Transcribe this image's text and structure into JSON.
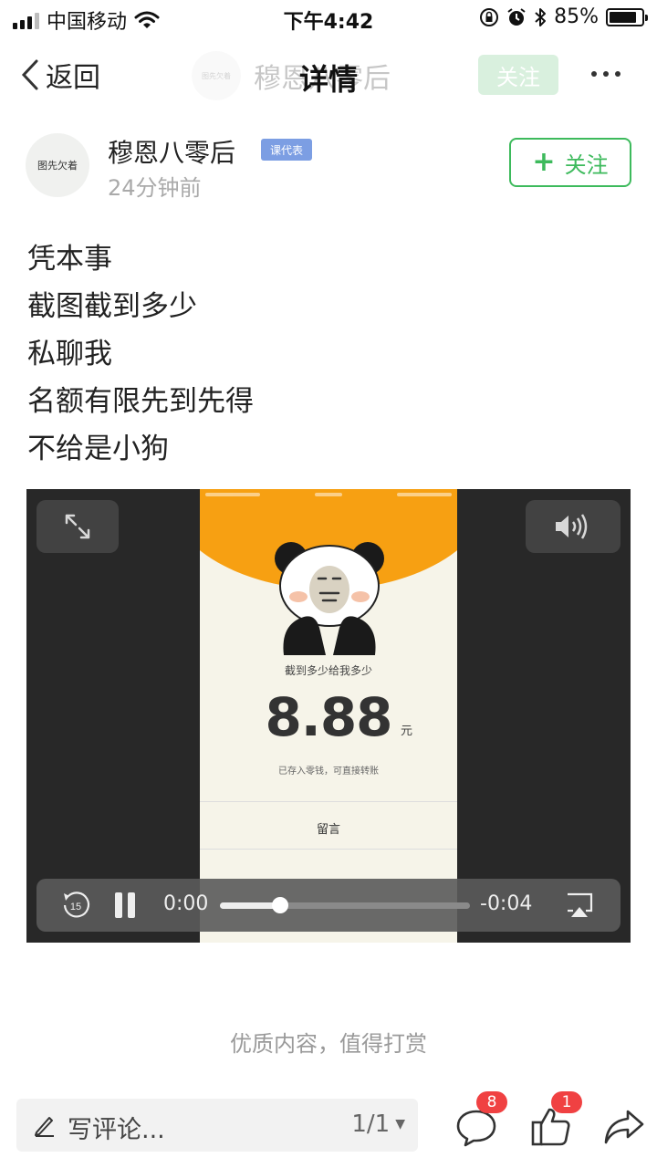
{
  "status_bar": {
    "carrier": "中国移动",
    "time": "下午4:42",
    "battery_percent": "85%",
    "battery_level": 0.85,
    "icons": [
      "signal-icon",
      "wifi-icon",
      "orientation-lock-icon",
      "alarm-icon",
      "bluetooth-icon",
      "battery-icon"
    ]
  },
  "nav": {
    "back_label": "返回",
    "title": "详情",
    "faded_author_name": "穆恩八零后",
    "faded_avatar_text": "图先欠着",
    "faded_follow_label": "关注",
    "more_icon": "more-dots-icon"
  },
  "author": {
    "avatar_text": "图先欠着",
    "name": "穆恩八零后",
    "badge": "课代表",
    "time": "24分钟前",
    "follow_label": "关注"
  },
  "post": {
    "lines": [
      "凭本事",
      "截图截到多少",
      "私聊我",
      "名额有限先到先得",
      "不给是小狗"
    ]
  },
  "video": {
    "frame_caption": "截到多少给我多少",
    "frame_amount": "8.88",
    "frame_unit": "元",
    "frame_note": "已存入零钱，可直接转账",
    "frame_message": "留言",
    "controls": {
      "current_time": "0:00",
      "remaining_time": "-0:04",
      "progress": 0.24,
      "replay_seconds": "15"
    }
  },
  "reward_text": "优质内容，值得打赏",
  "bottom_bar": {
    "comment_placeholder": "写评论...",
    "page_indicator": "1/1",
    "comment_count": "8",
    "like_count": "1"
  }
}
